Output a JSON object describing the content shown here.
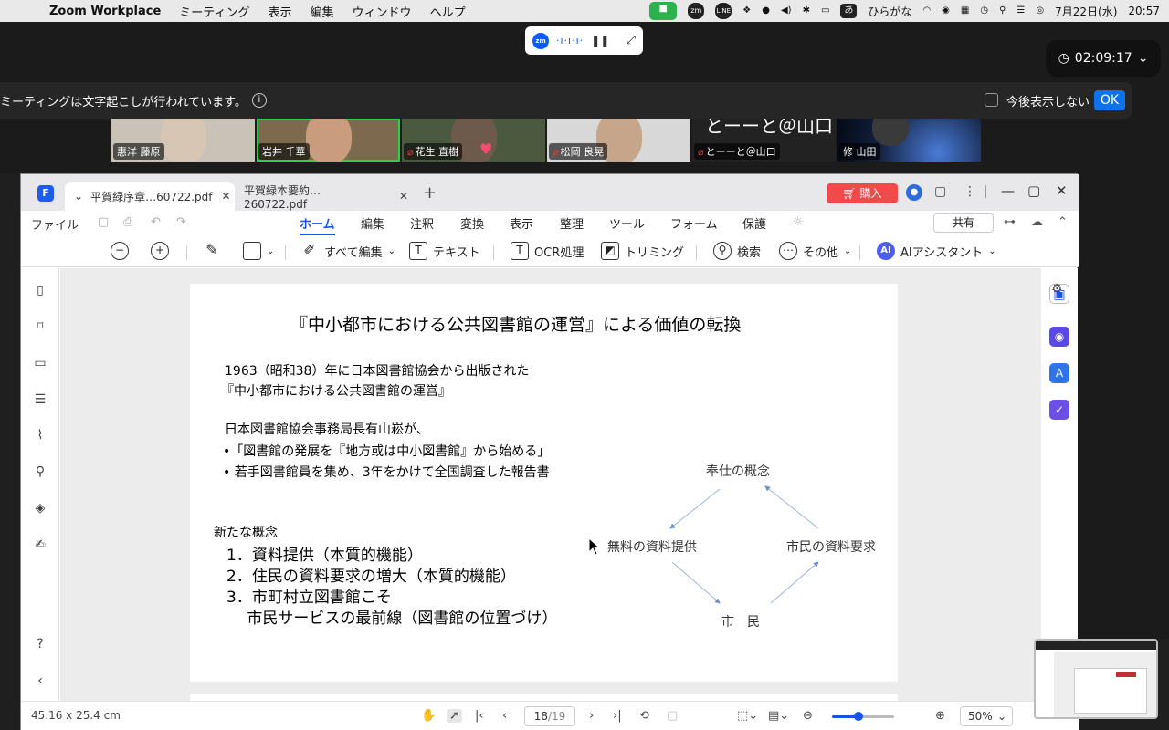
{
  "menubar": {
    "app_name": "Zoom Workplace",
    "items": [
      "ミーティング",
      "表示",
      "編集",
      "ウィンドウ",
      "ヘルプ"
    ],
    "status": {
      "zm": "zm",
      "line": "LINE",
      "ime_char": "あ",
      "ime_label": "ひらがな",
      "date": "7月22日(水)",
      "time": "20:57"
    }
  },
  "zoom": {
    "recorder_logo": "zm",
    "timer": "02:09:17",
    "caption_notice": "ミーティングは文字起こしが行われています。",
    "dont_show_label": "今後表示しない",
    "ok_label": "OK",
    "participants": [
      {
        "name": "惠洋 藤原",
        "muted": false
      },
      {
        "name": "岩井 千華",
        "muted": false
      },
      {
        "name": "花生 直樹",
        "muted": true
      },
      {
        "name": "松岡 良晃",
        "muted": true
      },
      {
        "name": "とーーと＠山口",
        "muted": true,
        "tile_text": "とーーと＠山口"
      },
      {
        "name": "修 山田",
        "muted": false
      }
    ]
  },
  "pdf": {
    "tabs": [
      {
        "label": "平賀緑序章…60722.pdf",
        "active": true
      },
      {
        "label": "平賀緑本要約…260722.pdf",
        "active": false
      }
    ],
    "buy_label": "購入",
    "file_label": "ファイル",
    "menus": [
      {
        "label": "ホーム",
        "active": true
      },
      {
        "label": "編集"
      },
      {
        "label": "注釈"
      },
      {
        "label": "変換"
      },
      {
        "label": "表示"
      },
      {
        "label": "整理"
      },
      {
        "label": "ツール"
      },
      {
        "label": "フォーム"
      },
      {
        "label": "保護"
      }
    ],
    "share_label": "共有",
    "tools": {
      "edit_all": "すべて編集",
      "text": "テキスト",
      "ocr": "OCR処理",
      "trim": "トリミング",
      "search": "検索",
      "more": "その他",
      "ai_badge": "AI",
      "ai": "AIアシスタント"
    },
    "slide": {
      "title": "『中小都市における公共図書館の運営』による価値の転換",
      "lines": [
        "1963（昭和38）年に日本図書館協会から出版された",
        "『中小都市における公共図書館の運営』",
        "日本図書館協会事務局長有山崧が、",
        "•「図書館の発展を『地方或は中小図書館』から始める」",
        "• 若手図書館員を集め、3年をかけて全国調査した報告書",
        "新たな概念"
      ],
      "big_lines": [
        "1．資料提供（本質的機能）",
        "2．住民の資料要求の増大（本質的機能）",
        "3．市町村立図書館こそ",
        "　  市民サービスの最前線（図書館の位置づけ）"
      ],
      "diagram": {
        "top": "奉仕の概念",
        "left": "無料の資料提供",
        "right": "市民の資料要求",
        "bottom": "市　民"
      }
    },
    "status": {
      "dimensions": "45.16 x 25.4 cm",
      "current_page": "18",
      "total_pages": "/19",
      "zoom": "50%",
      "zoom_fraction": 0.42
    }
  }
}
